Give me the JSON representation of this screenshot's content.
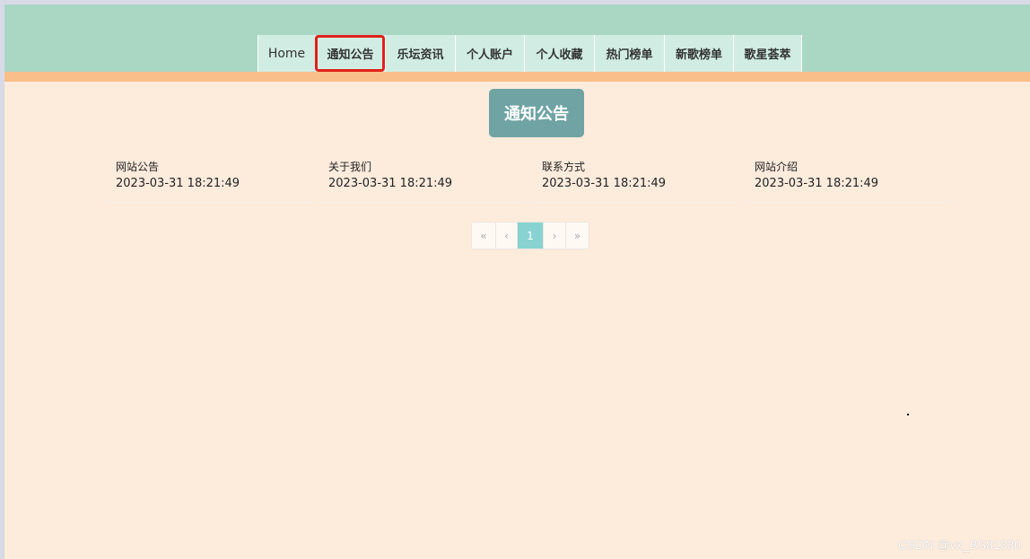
{
  "nav": {
    "items": [
      {
        "label": "Home",
        "active": false
      },
      {
        "label": "通知公告",
        "active": true
      },
      {
        "label": "乐坛资讯",
        "active": false
      },
      {
        "label": "个人账户",
        "active": false
      },
      {
        "label": "个人收藏",
        "active": false
      },
      {
        "label": "热门榜单",
        "active": false
      },
      {
        "label": "新歌榜单",
        "active": false
      },
      {
        "label": "歌星荟萃",
        "active": false
      }
    ]
  },
  "page": {
    "title": "通知公告"
  },
  "notices": [
    {
      "title": "网站公告",
      "date": "2023-03-31 18:21:49"
    },
    {
      "title": "关于我们",
      "date": "2023-03-31 18:21:49"
    },
    {
      "title": "联系方式",
      "date": "2023-03-31 18:21:49"
    },
    {
      "title": "网站介绍",
      "date": "2023-03-31 18:21:49"
    }
  ],
  "pagination": {
    "first": "«",
    "prev": "‹",
    "current": "1",
    "next": "›",
    "last": "»"
  },
  "colors": {
    "header": "#a9d7c4",
    "stripe": "#f9bf8a",
    "background": "#fdebdc",
    "title_badge": "#6fa3a4",
    "active_outline": "#e0221b",
    "page_current": "#88d3d1"
  },
  "watermark": "CSDN @vx_BS81330"
}
